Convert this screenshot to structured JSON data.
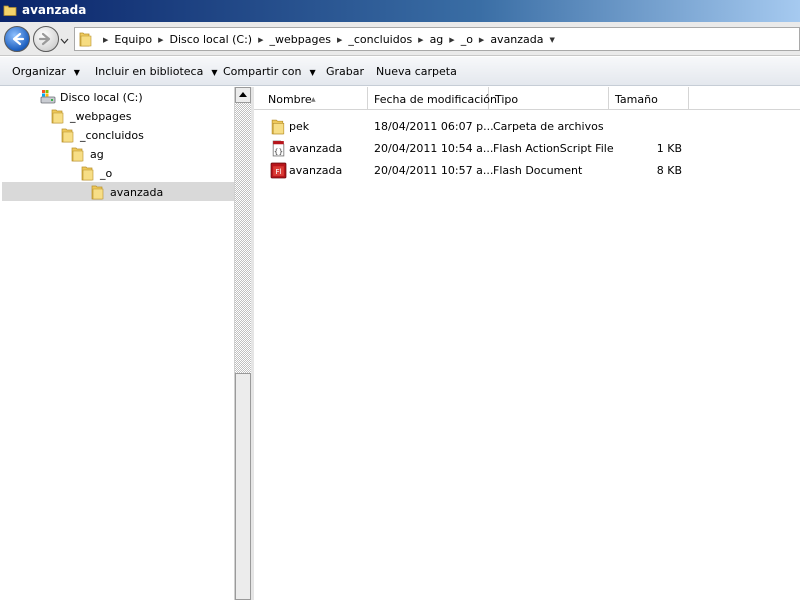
{
  "window": {
    "title": "avanzada"
  },
  "address": {
    "crumbs": [
      "Equipo",
      "Disco local (C:)",
      "_webpages",
      "_concluidos",
      "ag",
      "_o",
      "avanzada"
    ]
  },
  "toolbar": {
    "organize": "Organizar",
    "include_library": "Incluir en biblioteca",
    "share_with": "Compartir con",
    "burn": "Grabar",
    "new_folder": "Nueva carpeta"
  },
  "tree": {
    "items": [
      {
        "label": "Disco local (C:)",
        "icon": "drive-icon"
      },
      {
        "label": "_webpages",
        "icon": "folder-icon"
      },
      {
        "label": "_concluidos",
        "icon": "folder-icon"
      },
      {
        "label": "ag",
        "icon": "folder-icon"
      },
      {
        "label": "_o",
        "icon": "folder-icon"
      },
      {
        "label": "avanzada",
        "icon": "folder-icon",
        "selected": true
      }
    ]
  },
  "columns": {
    "name": "Nombre",
    "modified": "Fecha de modificación",
    "type": "Tipo",
    "size": "Tamaño"
  },
  "files": [
    {
      "name": "pek",
      "modified": "18/04/2011 06:07 p...",
      "type": "Carpeta de archivos",
      "size": "",
      "icon": "folder-icon"
    },
    {
      "name": "avanzada",
      "modified": "20/04/2011 10:54 a...",
      "type": "Flash ActionScript File",
      "size": "1 KB",
      "icon": "actionscript-file-icon"
    },
    {
      "name": "avanzada",
      "modified": "20/04/2011 10:57 a...",
      "type": "Flash Document",
      "size": "8 KB",
      "icon": "flash-document-icon"
    }
  ]
}
